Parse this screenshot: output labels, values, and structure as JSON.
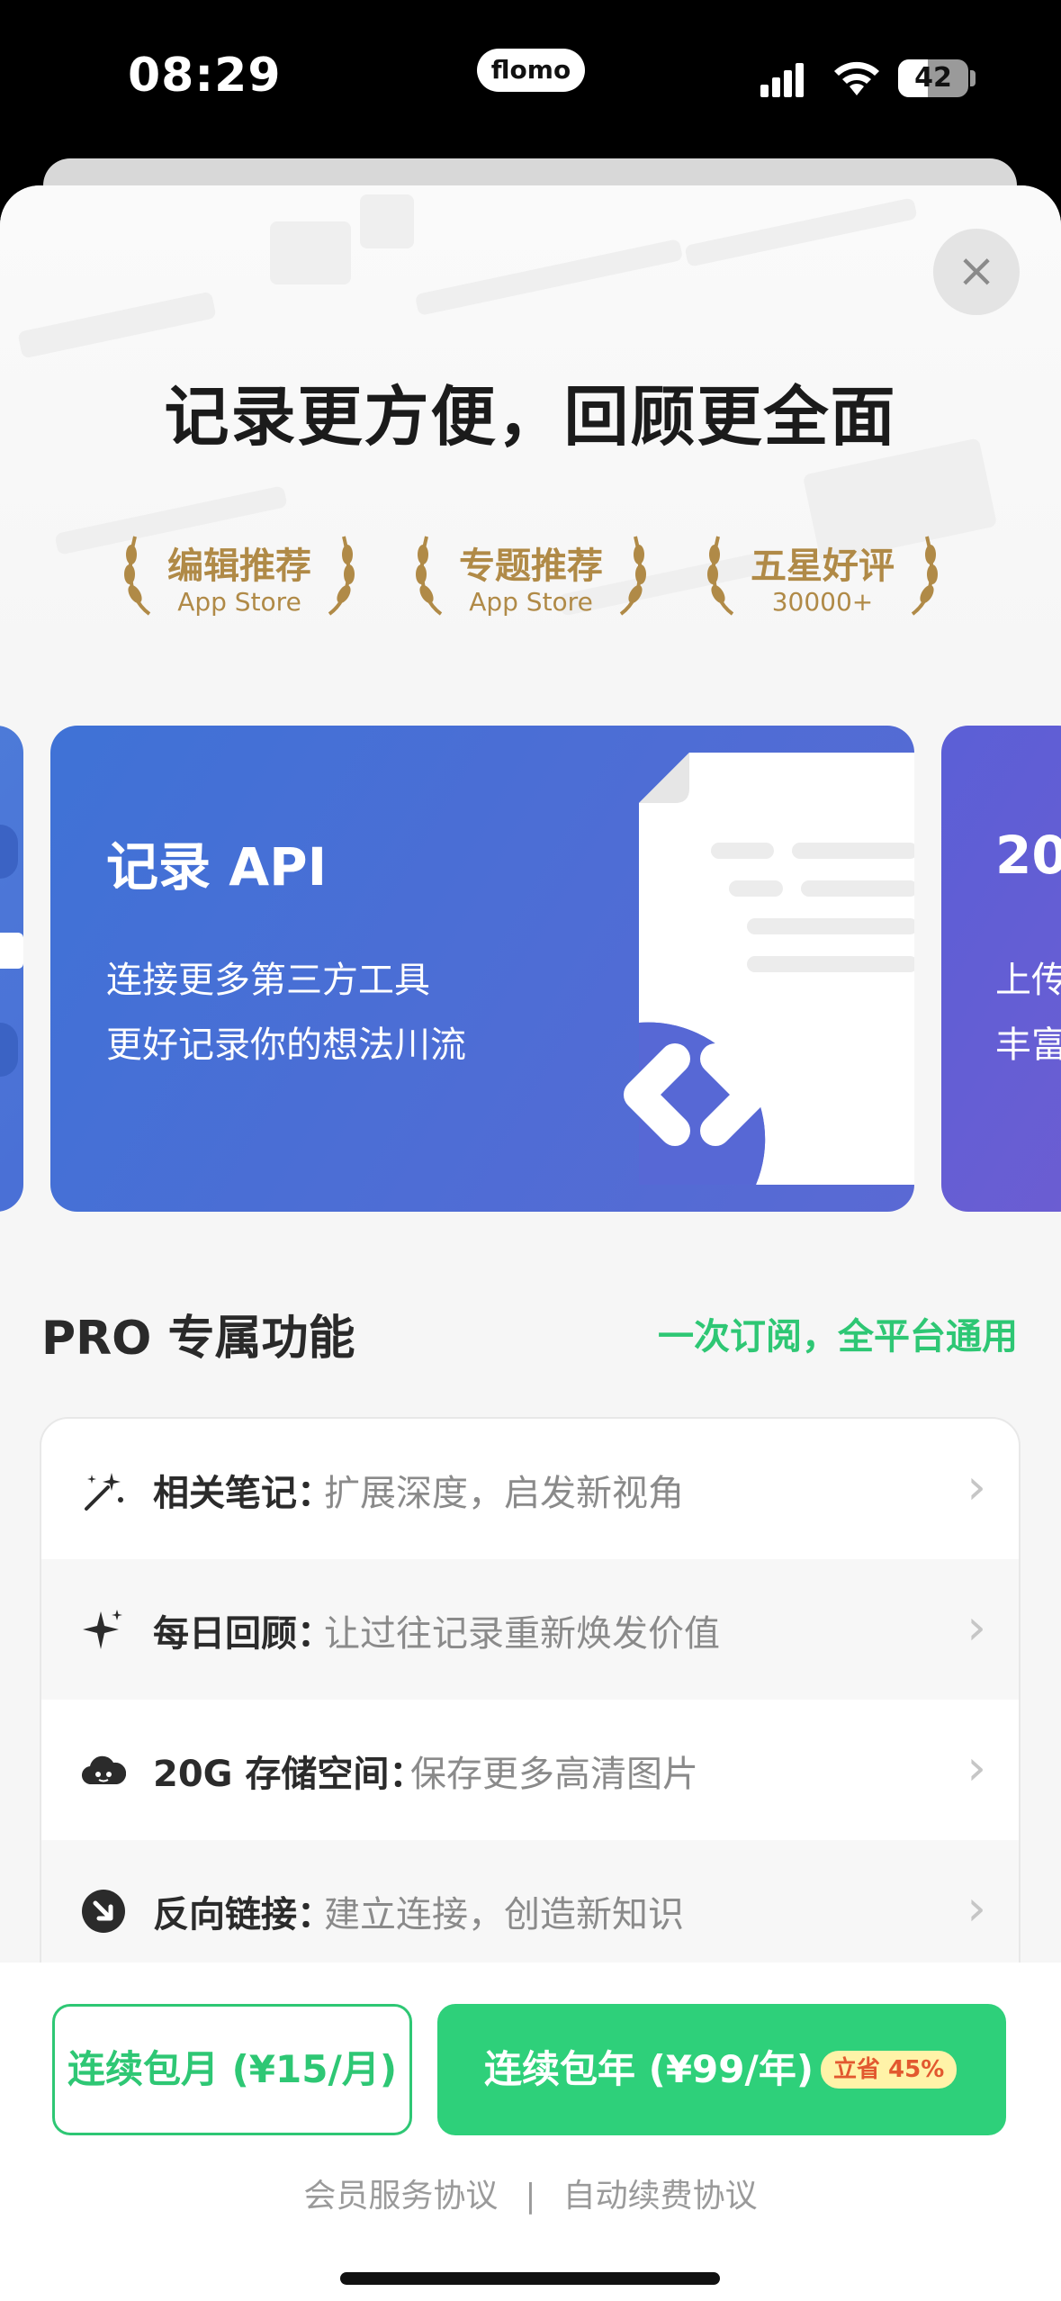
{
  "status_bar": {
    "time": "08:29",
    "app_pill": "flomo",
    "battery": "42",
    "battery_level": 0.42
  },
  "headline": "记录更方便，回顾更全面",
  "awards": [
    {
      "title": "编辑推荐",
      "subtitle": "App Store"
    },
    {
      "title": "专题推荐",
      "subtitle": "App Store"
    },
    {
      "title": "五星好评",
      "subtitle": "30000+"
    }
  ],
  "carousel": {
    "main": {
      "title": "记录 API",
      "lines": [
        "连接更多第三方工具",
        "更好记录你的想法川流"
      ]
    },
    "next": {
      "title": "20",
      "lines": [
        "上传",
        "丰富"
      ]
    }
  },
  "pro": {
    "title": "PRO 专属功能",
    "note": "一次订阅，全平台通用",
    "features": [
      {
        "name": "相关笔记：",
        "desc": "扩展深度，启发新视角",
        "icon": "sparkle-wand-icon"
      },
      {
        "name": "每日回顾：",
        "desc": "让过往记录重新焕发价值",
        "icon": "sparkle-icon"
      },
      {
        "name": "20G 存储空间：",
        "desc": "保存更多高清图片",
        "icon": "cloud-icon"
      },
      {
        "name": "反向链接：",
        "desc": "建立连接，创造新知识",
        "icon": "arrow-down-right-icon"
      }
    ]
  },
  "purchase": {
    "monthly": "连续包月 (¥15/月)",
    "yearly": "连续包年 (¥99/年)",
    "badge": "立省 45%",
    "link_service": "会员服务协议",
    "link_separator": "|",
    "link_auto": "自动续费协议"
  },
  "colors": {
    "accent": "#2ed07a",
    "card_blue": "#4a6fd6",
    "gold": "#b08a47"
  }
}
